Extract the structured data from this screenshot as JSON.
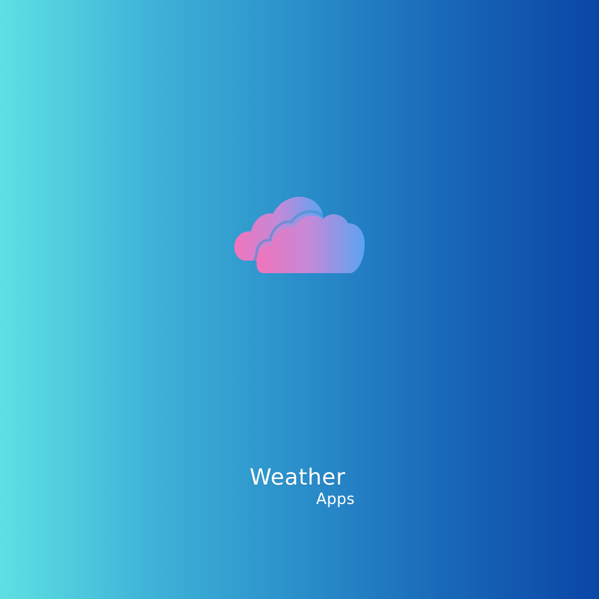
{
  "splash": {
    "logo_icon": "cloud-icon",
    "title": "Weather",
    "subtitle": "Apps"
  },
  "colors": {
    "background_left": "#5ee0e3",
    "background_right": "#0a46a6",
    "cloud_pink": "#f274bd",
    "cloud_blue": "#5da3f3",
    "text": "#ffffff"
  }
}
